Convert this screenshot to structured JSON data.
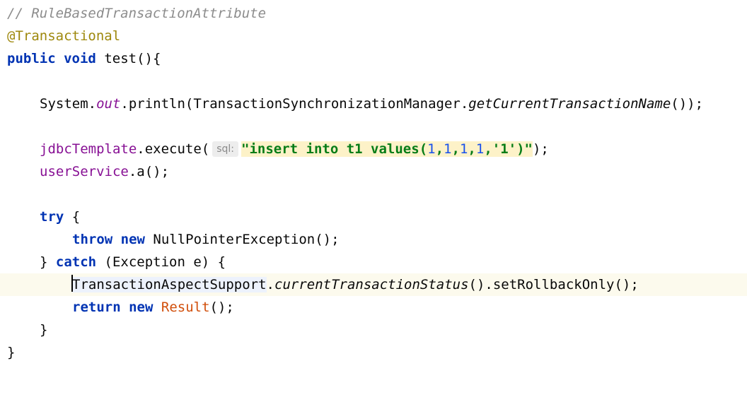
{
  "editor": {
    "comment": "// RuleBasedTransactionAttribute",
    "annotation": "@Transactional",
    "signature": {
      "kw_public": "public",
      "kw_void": "void",
      "method": "test(){"
    },
    "println_line": {
      "system": "System.",
      "out": "out",
      "println": ".println(TransactionSynchronizationManager.",
      "getName": "getCurrentTransactionName",
      "end": "());"
    },
    "execute_line": {
      "field": "jdbcTemplate",
      "call": ".execute(",
      "hint": "sql:",
      "str_open": "\"insert into t1 values(",
      "n1": "1",
      "c1": ",",
      "n2": "1",
      "c2": ",",
      "n3": "1",
      "c3": ",",
      "n4": "1",
      "c4": ",",
      "str_q": "'1')\"",
      "end": ");"
    },
    "userservice_line": {
      "field": "userService",
      "call": ".a();"
    },
    "try_line": {
      "kw": "try",
      "rest": " {"
    },
    "throw_line": {
      "kw_throw": "throw",
      "kw_new": "new",
      "rest": " NullPointerException();"
    },
    "catch_line": {
      "open": "} ",
      "kw": "catch",
      "rest": " (Exception e) {"
    },
    "rollback_line": {
      "cls": "TransactionAspectSupport",
      "dot": ".",
      "method": "currentTransactionStatus",
      "rest": "().setRollbackOnly();"
    },
    "return_line": {
      "kw_return": "return",
      "kw_new": "new",
      "cls": "Result",
      "rest": "();"
    },
    "close_catch": "}",
    "close_method": "}"
  }
}
